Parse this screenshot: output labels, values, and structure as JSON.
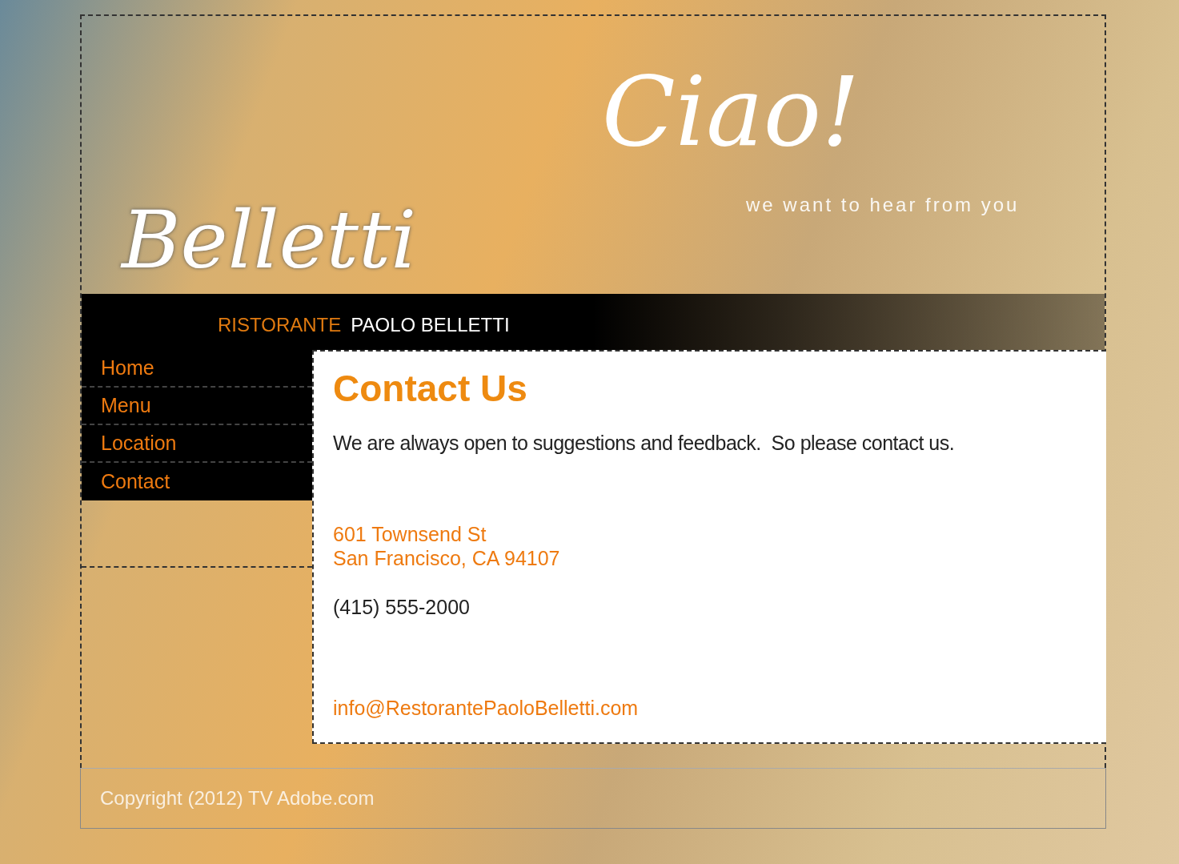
{
  "header": {
    "logo": "Belletti",
    "script_greeting": "Ciao!",
    "tagline": "we want to hear from you",
    "brand_prefix": "RISTORANTE",
    "brand_name": "PAOLO BELLETTI"
  },
  "nav": [
    {
      "label": "Home"
    },
    {
      "label": "Menu"
    },
    {
      "label": "Location"
    },
    {
      "label": "Contact"
    }
  ],
  "content": {
    "heading": "Contact Us",
    "intro": "We are always open to suggestions and feedback.  So please contact us.",
    "address": [
      "601 Townsend St",
      "San Francisco, CA 94107"
    ],
    "phone": "(415) 555-2000",
    "email": "info@RestorantePaoloBelletti.com"
  },
  "footer": "Copyright (2012) TV Adobe.com"
}
